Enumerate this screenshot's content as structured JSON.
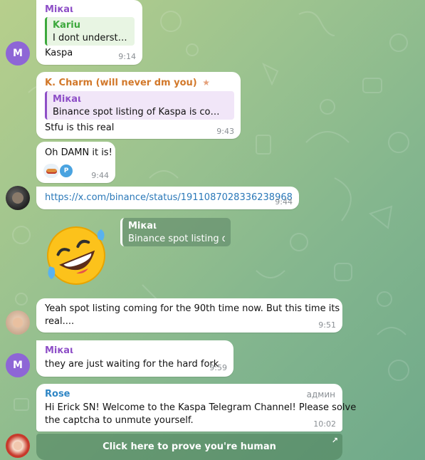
{
  "messages": {
    "m1": {
      "sender": "Mікаι",
      "reply": {
        "name": "Kariu",
        "text": "I dont understand"
      },
      "text": "Kaspa",
      "time": "9:14",
      "avatar_letter": "M"
    },
    "m2": {
      "sender": "K. Charm (will never dm you)",
      "reply": {
        "name": "Mікаι",
        "text": "Binance spot listing of Kaspa is coming"
      },
      "text": "Stfu is this real",
      "time": "9:43"
    },
    "m3": {
      "text": "Oh DAMN it is!",
      "reactions": [
        "hotdog",
        "badge"
      ],
      "reaction_badge_label": "P",
      "time": "9:44"
    },
    "m4": {
      "link": "https://x.com/binance/status/1911087028336238968",
      "time": "9:44"
    },
    "m5": {
      "reply": {
        "name": "Mікаι",
        "text": "Binance spot listing o..."
      }
    },
    "m6": {
      "text_line1": "Yeah spot listing coming for the 90th time now. But this time its",
      "text_line2": "real....",
      "time": "9:51"
    },
    "m7": {
      "sender": "Mікаι",
      "text": "they are just waiting for the hard fork",
      "time": "9:59",
      "avatar_letter": "M"
    },
    "m8": {
      "sender": "Rose",
      "role": "админ",
      "text_line1": "Hi Erick SN! Welcome to the Kaspa Telegram Channel! Please solve",
      "text_line2": "the captcha to unmute yourself.",
      "time": "10:02",
      "button_label": "Click here to prove you're human"
    }
  },
  "colors": {
    "mikai": "#8e4fc7",
    "kariu": "#3da93d",
    "kcharm": "#d2782a",
    "rose": "#2f86c5",
    "link": "#2a78b8",
    "avatar_m": "#8e66d6"
  }
}
